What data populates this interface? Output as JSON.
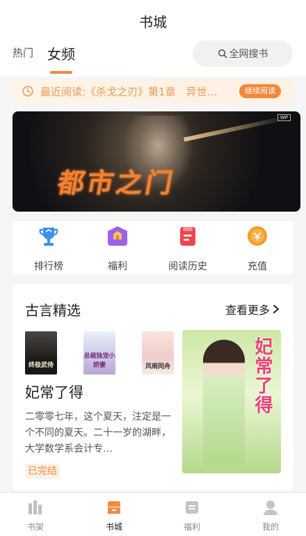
{
  "header": {
    "title": "书城",
    "tabs": [
      {
        "label": "热门",
        "active": false
      },
      {
        "label": "女频",
        "active": true
      }
    ],
    "search_label": "全网搜书"
  },
  "recent": {
    "text": "最近阅读:《杀戈之刃》第1章　异世…",
    "button": "继续阅读"
  },
  "banner": {
    "title": "都市之门",
    "badge": "WP"
  },
  "shortcuts": [
    {
      "label": "排行榜",
      "icon": "trophy-icon"
    },
    {
      "label": "福利",
      "icon": "gift-house-icon"
    },
    {
      "label": "阅读历史",
      "icon": "history-book-icon"
    },
    {
      "label": "充值",
      "icon": "coin-icon"
    }
  ],
  "section": {
    "title": "古言精选",
    "more": "查看更多",
    "small_covers": [
      {
        "title": "终极武侍"
      },
      {
        "title": "总裁独宠小娇妻"
      },
      {
        "title": "风雨同舟"
      }
    ],
    "featured": {
      "cover_text": "妃常了得",
      "title": "妃常了得",
      "description": "二零零七年，这个夏天，注定是一个不同的夏天。二十一岁的湖畔，大学数学系会计专…",
      "status": "已完结"
    }
  },
  "bottom_nav": [
    {
      "label": "书架",
      "icon": "bookshelf-icon",
      "active": false
    },
    {
      "label": "书城",
      "icon": "bookstore-icon",
      "active": true
    },
    {
      "label": "福利",
      "icon": "welfare-icon",
      "active": false
    },
    {
      "label": "我的",
      "icon": "profile-icon",
      "active": false
    }
  ],
  "colors": {
    "accent": "#f08a3e",
    "background": "#f5f5f5"
  }
}
